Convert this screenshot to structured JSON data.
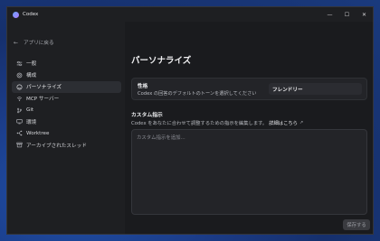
{
  "window": {
    "title": "Codex",
    "controls": {
      "minimize": "—",
      "maximize": "☐",
      "close": "✕"
    }
  },
  "sidebar": {
    "back_label": "アプリに戻る",
    "items": [
      {
        "label": "一般",
        "icon": "sliders-icon",
        "active": false
      },
      {
        "label": "構成",
        "icon": "gear-icon",
        "active": false
      },
      {
        "label": "パーソナライズ",
        "icon": "personalize-icon",
        "active": true
      },
      {
        "label": "MCP サーバー",
        "icon": "mcp-icon",
        "active": false
      },
      {
        "label": "Git",
        "icon": "git-icon",
        "active": false
      },
      {
        "label": "環境",
        "icon": "monitor-icon",
        "active": false
      },
      {
        "label": "Worktree",
        "icon": "worktree-icon",
        "active": false
      },
      {
        "label": "アーカイブされたスレッド",
        "icon": "archive-icon",
        "active": false
      }
    ]
  },
  "main": {
    "title": "パーソナライズ",
    "personality": {
      "label": "性格",
      "description": "Codex の回答のデフォルトのトーンを選択してください",
      "value": "フレンドリー"
    },
    "custom": {
      "title": "カスタム指示",
      "description": "Codex をあなたに合わせて調整するための指示を編集します。",
      "link": "詳細はこちら",
      "placeholder": "カスタム指示を追加..."
    },
    "save_label": "保存する"
  }
}
